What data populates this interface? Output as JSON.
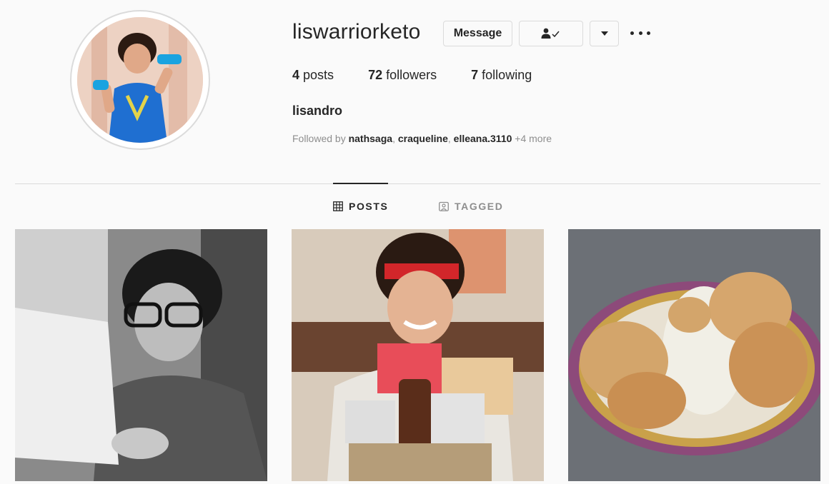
{
  "profile": {
    "username": "liswarriorketo",
    "full_name": "lisandro",
    "stats": {
      "posts": "4",
      "posts_label": "posts",
      "followers": "72",
      "followers_label": "followers",
      "following": "7",
      "following_label": "following"
    },
    "followed_by": {
      "prefix": "Followed by ",
      "users": [
        "nathsaga",
        "craqueline",
        "elleana.3110"
      ],
      "sep1": ", ",
      "sep2": ", ",
      "more": " +4 more"
    }
  },
  "actions": {
    "message_label": "Message",
    "follow_icon": "person-check-icon",
    "dropdown_icon": "caret-down-icon",
    "more_icon": "more-options-icon"
  },
  "tabs": [
    {
      "label": "POSTS",
      "icon": "grid-icon",
      "active": true
    },
    {
      "label": "TAGGED",
      "icon": "tag-user-icon",
      "active": false
    }
  ],
  "colors": {
    "text": "#262626",
    "muted": "#8e8e8e",
    "border": "#dbdbdb",
    "background": "#fafafa"
  }
}
